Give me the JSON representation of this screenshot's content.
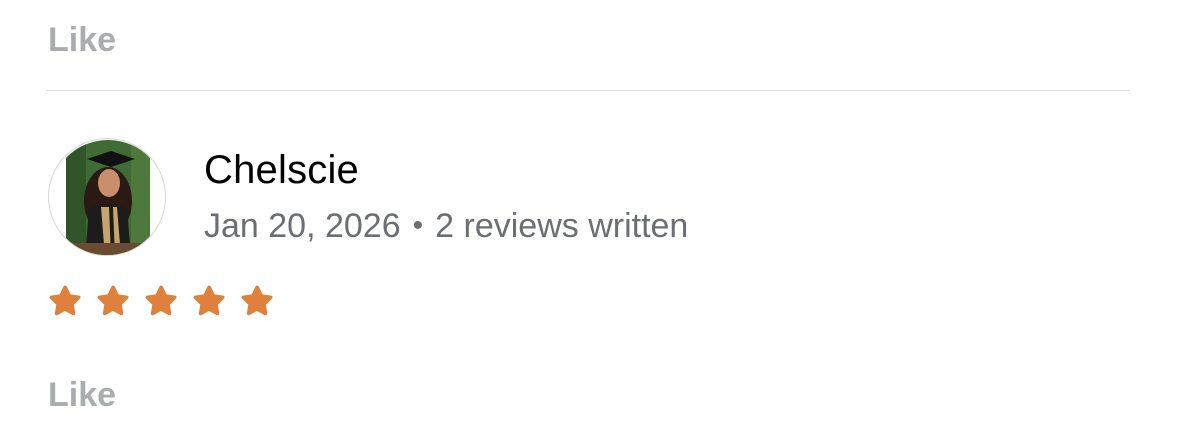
{
  "top_action": {
    "like_label": "Like"
  },
  "review": {
    "reviewer_name": "Chelscie",
    "date": "Jan 20, 2026",
    "separator": "•",
    "reviews_written": "2 reviews written",
    "rating": 5,
    "rating_max": 5,
    "star_color": "#e0803a",
    "avatar_icon": "user-photo"
  },
  "bottom_action": {
    "like_label": "Like"
  }
}
